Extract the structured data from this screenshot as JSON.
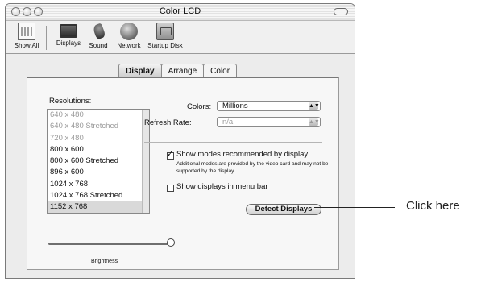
{
  "window": {
    "title": "Color LCD"
  },
  "toolbar": {
    "items": [
      {
        "label": "Show All",
        "icon": "grid-icon"
      },
      {
        "label": "Displays",
        "icon": "display-icon"
      },
      {
        "label": "Sound",
        "icon": "speaker-icon"
      },
      {
        "label": "Network",
        "icon": "globe-icon"
      },
      {
        "label": "Startup Disk",
        "icon": "disk-icon"
      }
    ]
  },
  "tabs": [
    {
      "label": "Display",
      "selected": true
    },
    {
      "label": "Arrange",
      "selected": false
    },
    {
      "label": "Color",
      "selected": false
    }
  ],
  "display": {
    "resolutions_label": "Resolutions:",
    "resolutions": [
      "640 x 480",
      "640 x 480 Stretched",
      "720 x 480",
      "800 x 600",
      "800 x 600 Stretched",
      "896 x 600",
      "1024 x 768",
      "1024 x 768 Stretched",
      "1152 x 768"
    ],
    "selected_resolution": "1152 x 768",
    "colors_label": "Colors:",
    "colors_value": "Millions",
    "refresh_label": "Refresh Rate:",
    "refresh_value": "n/a",
    "show_modes_label": "Show modes recommended by display",
    "show_modes_checked": true,
    "note": "Additional modes are provided by the video card and may not be supported by the display.",
    "show_in_menu_label": "Show displays in menu bar",
    "show_in_menu_checked": false,
    "detect_button": "Detect Displays",
    "brightness_label": "Brightness",
    "brightness_level": 1.0
  },
  "callout": {
    "text": "Click here"
  }
}
